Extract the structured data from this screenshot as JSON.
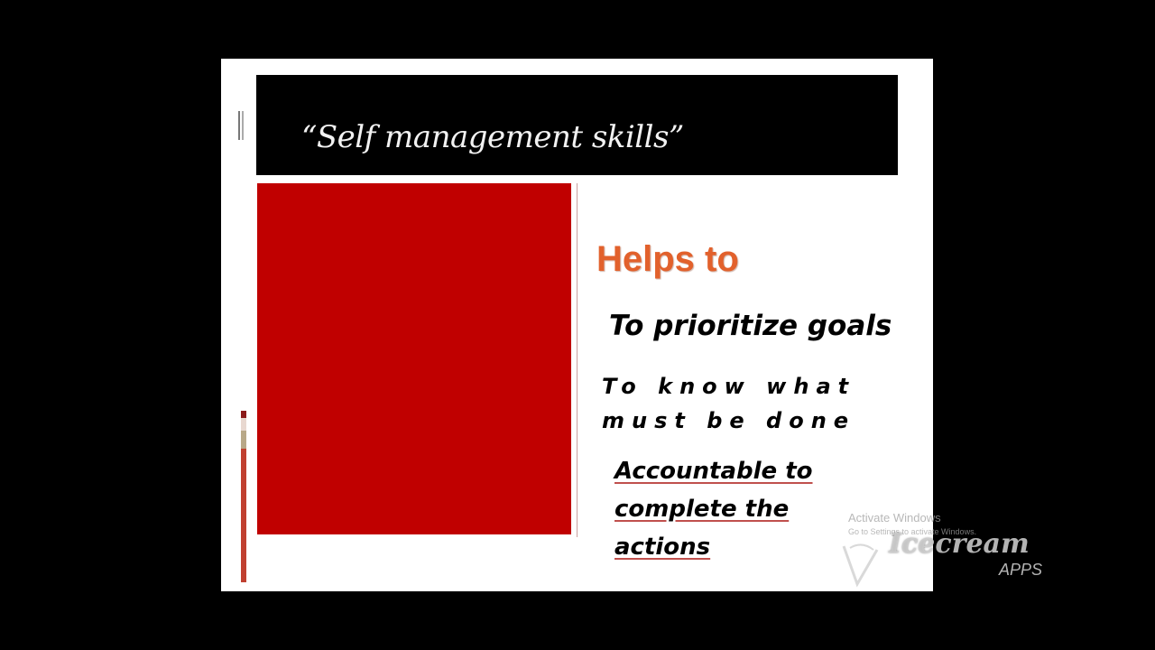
{
  "slide": {
    "title": "“Self management skills”",
    "heading": "Helps to",
    "points": [
      "To prioritize goals",
      "To know what must be done",
      "Accountable to complete the actions"
    ]
  },
  "overlay": {
    "activate_windows": "Activate Windows",
    "activate_sub": "Go to Settings to activate Windows.",
    "watermark_brand": "Icecream",
    "watermark_apps": "APPS"
  },
  "colors": {
    "background": "#000000",
    "slide": "#ffffff",
    "title_bar": "#000000",
    "red_panel": "#c00000",
    "heading": "#e2612c",
    "underline": "#c0504d"
  },
  "icons": {
    "watermark_logo": "icecream-logo-icon",
    "title_marker": "title-bullet-marker-icon"
  }
}
